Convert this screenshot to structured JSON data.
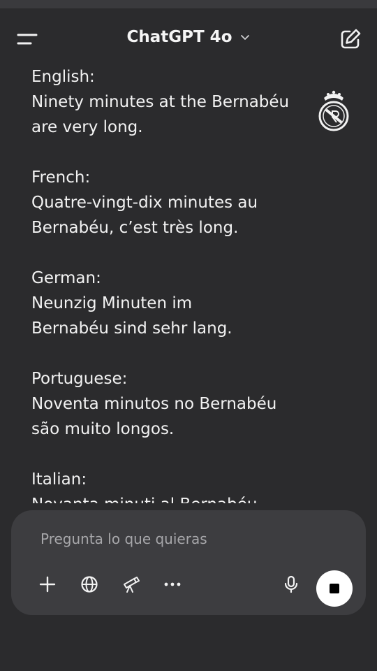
{
  "header": {
    "title": "ChatGPT 4o"
  },
  "message": {
    "blocks": [
      {
        "heading": "English:",
        "lines": [
          "Ninety minutes at the Bernabéu",
          "are very long."
        ]
      },
      {
        "heading": "French:",
        "lines": [
          "Quatre-vingt-dix minutes au",
          "Bernabéu, c’est très long."
        ]
      },
      {
        "heading": "German:",
        "lines": [
          "Neunzig Minuten im",
          "Bernabéu sind sehr lang."
        ]
      },
      {
        "heading": "Portuguese:",
        "lines": [
          "Noventa minutos no Bernabéu",
          "são muito longos."
        ]
      },
      {
        "heading": "Italian:",
        "lines": [
          "Novanta minuti al Bernabéu",
          ""
        ]
      }
    ]
  },
  "composer": {
    "placeholder": "Pregunta lo que quieras",
    "tools": [
      "plus-icon",
      "globe-icon",
      "telescope-icon",
      "more-icon",
      "microphone-icon"
    ],
    "stop": "stop-icon"
  },
  "colors": {
    "background": "#2b2b2d",
    "composer": "#3d3d40",
    "text": "#f2f2f2",
    "placeholder": "#a7a7aa"
  }
}
